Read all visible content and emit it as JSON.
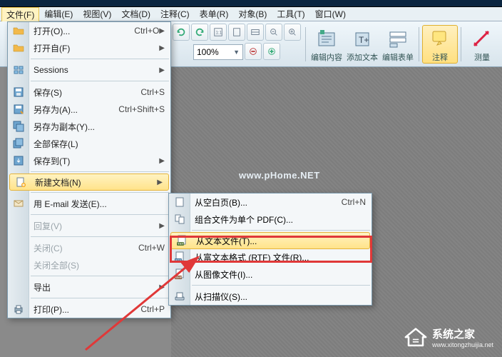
{
  "menubar": [
    "文件(F)",
    "编辑(E)",
    "视图(V)",
    "文档(D)",
    "注释(C)",
    "表单(R)",
    "对象(B)",
    "工具(T)",
    "窗口(W)"
  ],
  "toolbar": {
    "zoom": "100%",
    "groups": [
      "编辑内容",
      "添加文本",
      "编辑表单",
      "注释",
      "测量"
    ]
  },
  "file_menu": {
    "items": [
      {
        "icon": "folder",
        "label": "打开(O)...",
        "shortcut": "Ctrl+O",
        "arrow": true
      },
      {
        "icon": "folder",
        "label": "打开自(F)",
        "arrow": true
      },
      {
        "sep": true
      },
      {
        "icon": "sessions",
        "label": "Sessions",
        "arrow": true
      },
      {
        "sep": true
      },
      {
        "icon": "save",
        "label": "保存(S)",
        "shortcut": "Ctrl+S"
      },
      {
        "icon": "saveas",
        "label": "另存为(A)...",
        "shortcut": "Ctrl+Shift+S"
      },
      {
        "icon": "savecopy",
        "label": "另存为副本(Y)..."
      },
      {
        "icon": "saveall",
        "label": "全部保存(L)"
      },
      {
        "icon": "saveto",
        "label": "保存到(T)",
        "arrow": true
      },
      {
        "sep": true
      },
      {
        "icon": "newdoc",
        "label": "新建文档(N)",
        "arrow": true,
        "selected": true
      },
      {
        "sep": true
      },
      {
        "icon": "mail",
        "label": "用 E-mail 发送(E)..."
      },
      {
        "sep": true
      },
      {
        "label": "回复(V)",
        "arrow": true,
        "disabled": true
      },
      {
        "sep": true
      },
      {
        "label": "关闭(C)",
        "shortcut": "Ctrl+W",
        "disabled": true
      },
      {
        "label": "关闭全部(S)",
        "disabled": true
      },
      {
        "sep": true
      },
      {
        "label": "导出",
        "arrow": true
      },
      {
        "sep": true
      },
      {
        "icon": "print",
        "label": "打印(P)...",
        "shortcut": "Ctrl+P"
      }
    ]
  },
  "new_doc_submenu": {
    "items": [
      {
        "icon": "blank",
        "label": "从空白页(B)...",
        "shortcut": "Ctrl+N"
      },
      {
        "icon": "combine",
        "label": "组合文件为单个 PDF(C)..."
      },
      {
        "sep": true
      },
      {
        "icon": "txt",
        "label": "从文本文件(T)...",
        "selected": true
      },
      {
        "icon": "rtf",
        "label": "从富文本格式 (RTF) 文件(R)..."
      },
      {
        "icon": "bmp",
        "label": "从图像文件(I)..."
      },
      {
        "sep": true
      },
      {
        "icon": "scanner",
        "label": "从扫描仪(S)..."
      }
    ]
  },
  "watermark": "www.pHome.NET",
  "brand": {
    "cn": "系统之家",
    "en": "www.xitongzhuijia.net"
  }
}
